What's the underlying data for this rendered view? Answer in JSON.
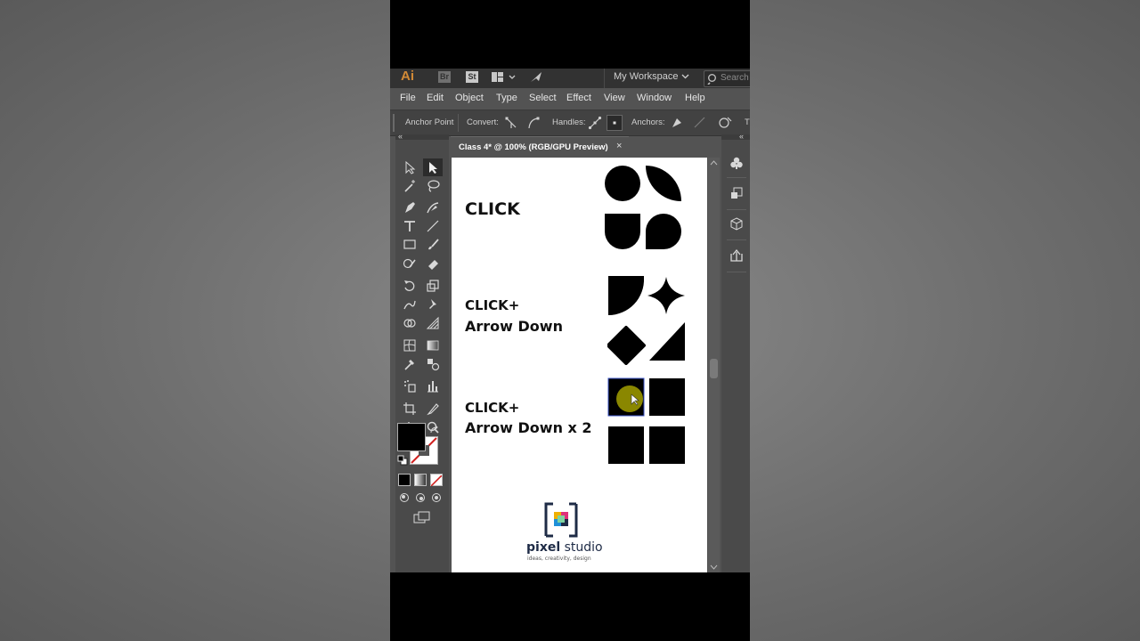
{
  "appbar": {
    "logo": "Ai",
    "bridge": "Br",
    "stock": "St",
    "workspace": "My Workspace",
    "search_placeholder": "Search"
  },
  "menu": [
    "File",
    "Edit",
    "Object",
    "Type",
    "Select",
    "Effect",
    "View",
    "Window",
    "Help"
  ],
  "control_bar": {
    "mode_label": "Anchor Point",
    "convert_label": "Convert:",
    "handles_label": "Handles:",
    "anchors_label": "Anchors:"
  },
  "document": {
    "tab_title": "Class 4* @ 100% (RGB/GPU Preview)",
    "close": "×"
  },
  "artboard": {
    "step1": "CLICK",
    "step2_line1": "CLICK+",
    "step2_line2": "Arrow Down",
    "step3_line1": "CLICK+",
    "step3_line2": "Arrow Down x 2",
    "brand_bold": "pixel",
    "brand_rest": " studio",
    "brand_tagline": "ideas, creativity, design"
  },
  "colors": {
    "ui_dark": "#323232",
    "ui_panel": "#535353",
    "ai_orange": "#d28a36",
    "fill": "#000000",
    "cursor_highlight": "#b8b400"
  }
}
